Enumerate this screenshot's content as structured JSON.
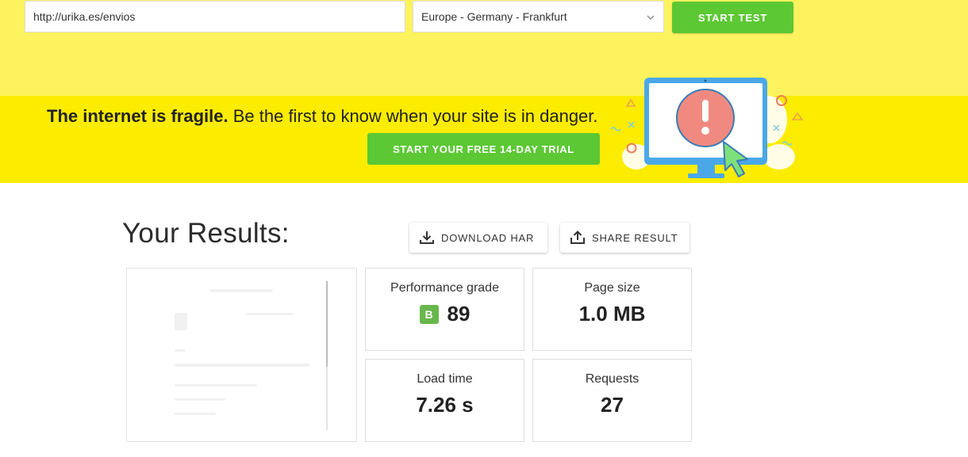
{
  "test_bar": {
    "url_value": "http://urika.es/envios",
    "location_selected": "Europe - Germany - Frankfurt",
    "start_label": "START TEST",
    "start_color": "#5cc834",
    "background": "#fdf35e"
  },
  "promo": {
    "headline_bold": "The internet is fragile.",
    "headline_rest": " Be the first to know when your site is in danger.",
    "trial_label": "START YOUR FREE 14-DAY TRIAL",
    "background": "#fcec00"
  },
  "results": {
    "title": "Your Results:",
    "download_label": "DOWNLOAD HAR",
    "share_label": "SHARE RESULT",
    "cards": {
      "performance": {
        "label": "Performance grade",
        "grade": "B",
        "score": "89"
      },
      "page_size": {
        "label": "Page size",
        "value": "1.0 MB"
      },
      "load_time": {
        "label": "Load time",
        "value": "7.26 s"
      },
      "requests": {
        "label": "Requests",
        "value": "27"
      }
    }
  },
  "icons": {
    "select_chevron": "chevron-down-icon",
    "download": "download-icon",
    "share": "share-icon",
    "illustration": "monitor-alert-illustration"
  }
}
